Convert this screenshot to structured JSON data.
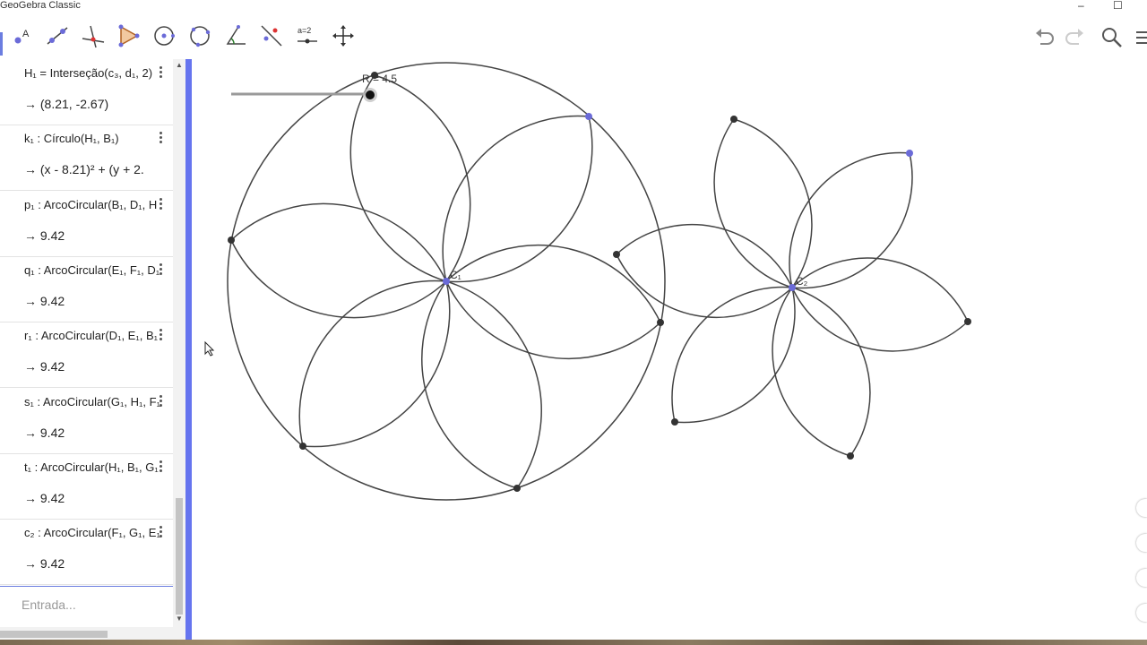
{
  "window": {
    "title": "GeoGebra Classic",
    "minimize": "–",
    "maximize": "☐"
  },
  "toolbar": {
    "tools": [
      "move-tool",
      "point-tool",
      "line-tool",
      "perpendicular-line-tool",
      "polygon-tool",
      "circle-center-point-tool",
      "circle-three-points-tool",
      "angle-tool",
      "reflect-tool",
      "slider-tool",
      "move-graphics-view-tool"
    ],
    "slider_tool_label": "a=2",
    "right": [
      "undo",
      "redo",
      "search",
      "menu"
    ]
  },
  "algebra": {
    "rows": [
      {
        "def": "H₁ = Interseção(c₃, d₁, 2)",
        "val": "→  (8.21, -2.67)"
      },
      {
        "def": "k₁ : Círculo(H₁, B₁)",
        "val": "→  (x - 8.21)² + (y + 2."
      },
      {
        "def": "p₁ : ArcoCircular(B₁, D₁, H",
        "val": "→  9.42"
      },
      {
        "def": "q₁ : ArcoCircular(E₁, F₁, D₁",
        "val": "→  9.42"
      },
      {
        "def": "r₁ : ArcoCircular(D₁, E₁, B₁",
        "val": "→  9.42"
      },
      {
        "def": "s₁ : ArcoCircular(G₁, H₁, F₁",
        "val": "→  9.42"
      },
      {
        "def": "t₁ : ArcoCircular(H₁, B₁, G₁",
        "val": "→  9.42"
      },
      {
        "def": "c₂ : ArcoCircular(F₁, G₁, E₁",
        "val": "→  9.42"
      }
    ],
    "input_placeholder": "Entrada..."
  },
  "graphics": {
    "slider_label": "R = 4.5",
    "center1_label": "C₁",
    "center2_label": "C₂",
    "colors": {
      "free_point": "#6b6bd8",
      "dependent_point": "#333333",
      "curve": "#444444",
      "slider": "#999999",
      "divider": "#6574ef"
    }
  }
}
